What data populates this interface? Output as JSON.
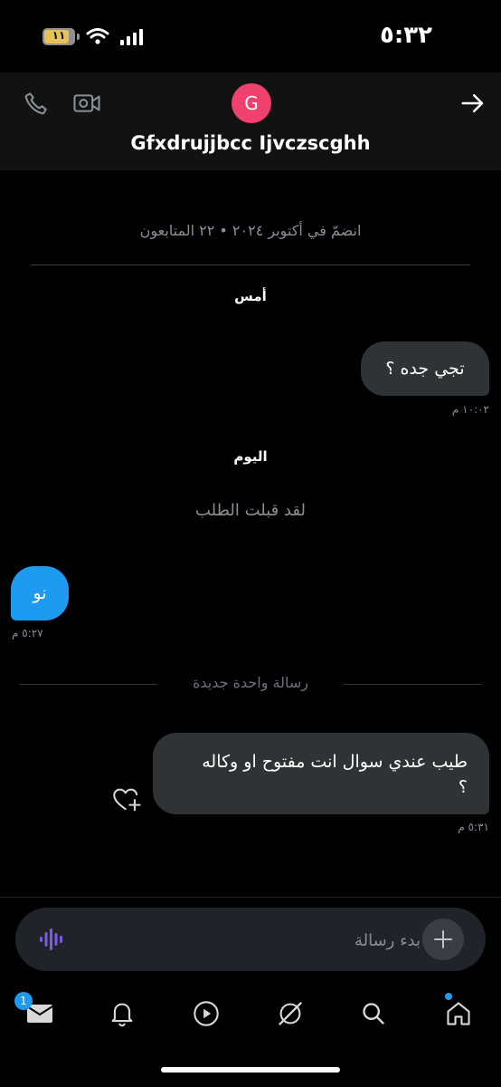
{
  "status_bar": {
    "time": "٥:٣٢",
    "battery_level": "١١"
  },
  "header": {
    "avatar_letter": "G",
    "avatar_color": "#f0416e",
    "contact_name": "Gfxdrujjbcc Ijvczscghh"
  },
  "conversation": {
    "joined_info": "انضمّ في أكتوبر ٢٠٢٤ • ٢٢ المتابعون",
    "day_yesterday": "أمس",
    "day_today": "اليوم",
    "system_message": "لقد قبلت الطلب",
    "new_message_separator": "رسالة واحدة جديدة",
    "messages": [
      {
        "direction": "outgoing",
        "text": "تجي جده ؟",
        "time": "١٠:٠٢ م"
      },
      {
        "direction": "incoming",
        "text": "نو",
        "time": "٥:٢٧ م"
      },
      {
        "direction": "outgoing",
        "line1": "طيب عندي سوال انت مفتوح او وكاله",
        "line2": "؟",
        "time": "٥:٣١ م"
      }
    ]
  },
  "composer": {
    "placeholder": "بدء رسالة"
  },
  "bottom_nav": {
    "items": [
      "mail-icon",
      "bell-icon",
      "play-icon",
      "grok-icon",
      "search-icon",
      "home-icon"
    ],
    "mail_badge": "1"
  },
  "colors": {
    "accent": "#1d9bf0",
    "outgoing_bubble": "#2f3336",
    "voice_icon": "#7b5ce6"
  }
}
